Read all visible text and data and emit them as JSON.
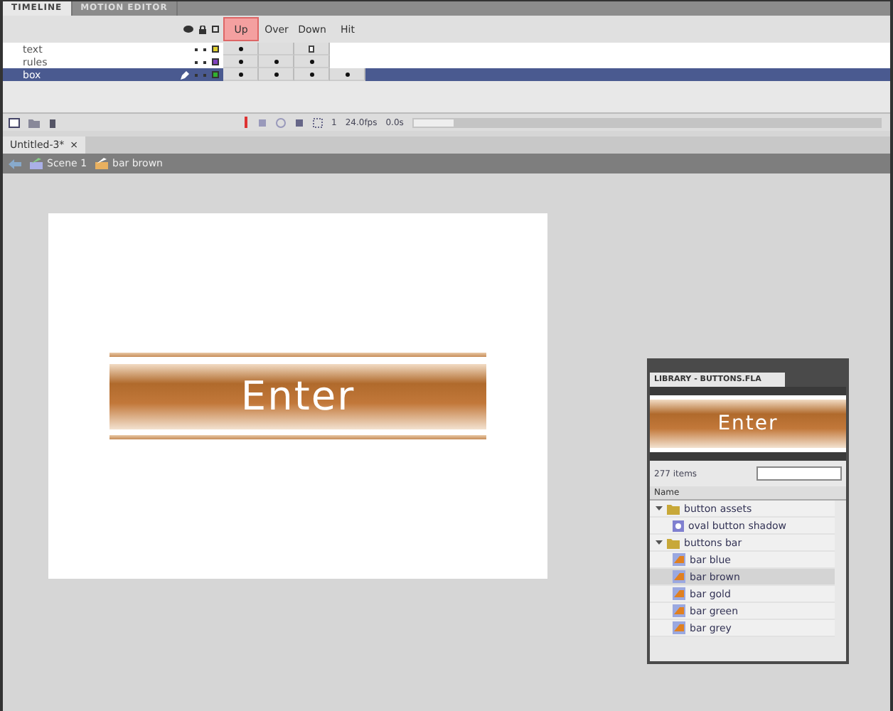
{
  "timeline": {
    "tabs": [
      {
        "label": "TIMELINE",
        "selected": true
      },
      {
        "label": "MOTION EDITOR",
        "selected": false
      }
    ],
    "frame_labels": [
      {
        "label": "Up",
        "selected": true
      },
      {
        "label": "Over",
        "selected": false
      },
      {
        "label": "Down",
        "selected": false
      },
      {
        "label": "Hit",
        "selected": false
      }
    ],
    "layers": [
      {
        "name": "text",
        "selected": false,
        "editing": false,
        "color": "#e0d030",
        "frames": [
          {
            "kind": "key"
          },
          {
            "kind": "span"
          },
          {
            "kind": "end"
          }
        ]
      },
      {
        "name": "rules",
        "selected": false,
        "editing": false,
        "color": "#8040c0",
        "frames": [
          {
            "kind": "key"
          },
          {
            "kind": "key"
          },
          {
            "kind": "key"
          }
        ]
      },
      {
        "name": "box",
        "selected": true,
        "editing": true,
        "color": "#30b030",
        "frames": [
          {
            "kind": "key"
          },
          {
            "kind": "key"
          },
          {
            "kind": "key"
          },
          {
            "kind": "key"
          }
        ]
      }
    ],
    "current_frame": "1",
    "frame_rate": "24.0fps",
    "elapsed": "0.0s"
  },
  "document_tab": {
    "title": "Untitled-3*",
    "close": "×"
  },
  "breadcrumb": [
    {
      "label": "Scene 1",
      "kind": "scene"
    },
    {
      "label": "bar brown",
      "kind": "symbol"
    }
  ],
  "stage": {
    "button_text": "Enter"
  },
  "library": {
    "title": "LIBRARY - BUTTONS.FLA",
    "preview_text": "Enter",
    "count": "277 items",
    "column": "Name",
    "items": [
      {
        "label": "button assets",
        "kind": "folder",
        "expanded": true,
        "selected": false,
        "children": [
          {
            "label": "oval button shadow",
            "kind": "graphic",
            "selected": false
          }
        ]
      },
      {
        "label": "buttons bar",
        "kind": "folder",
        "expanded": true,
        "selected": false,
        "children": [
          {
            "label": "bar blue",
            "kind": "button",
            "selected": false
          },
          {
            "label": "bar brown",
            "kind": "button",
            "selected": true
          },
          {
            "label": "bar gold",
            "kind": "button",
            "selected": false
          },
          {
            "label": "bar green",
            "kind": "button",
            "selected": false
          },
          {
            "label": "bar grey",
            "kind": "button",
            "selected": false
          }
        ]
      }
    ]
  }
}
